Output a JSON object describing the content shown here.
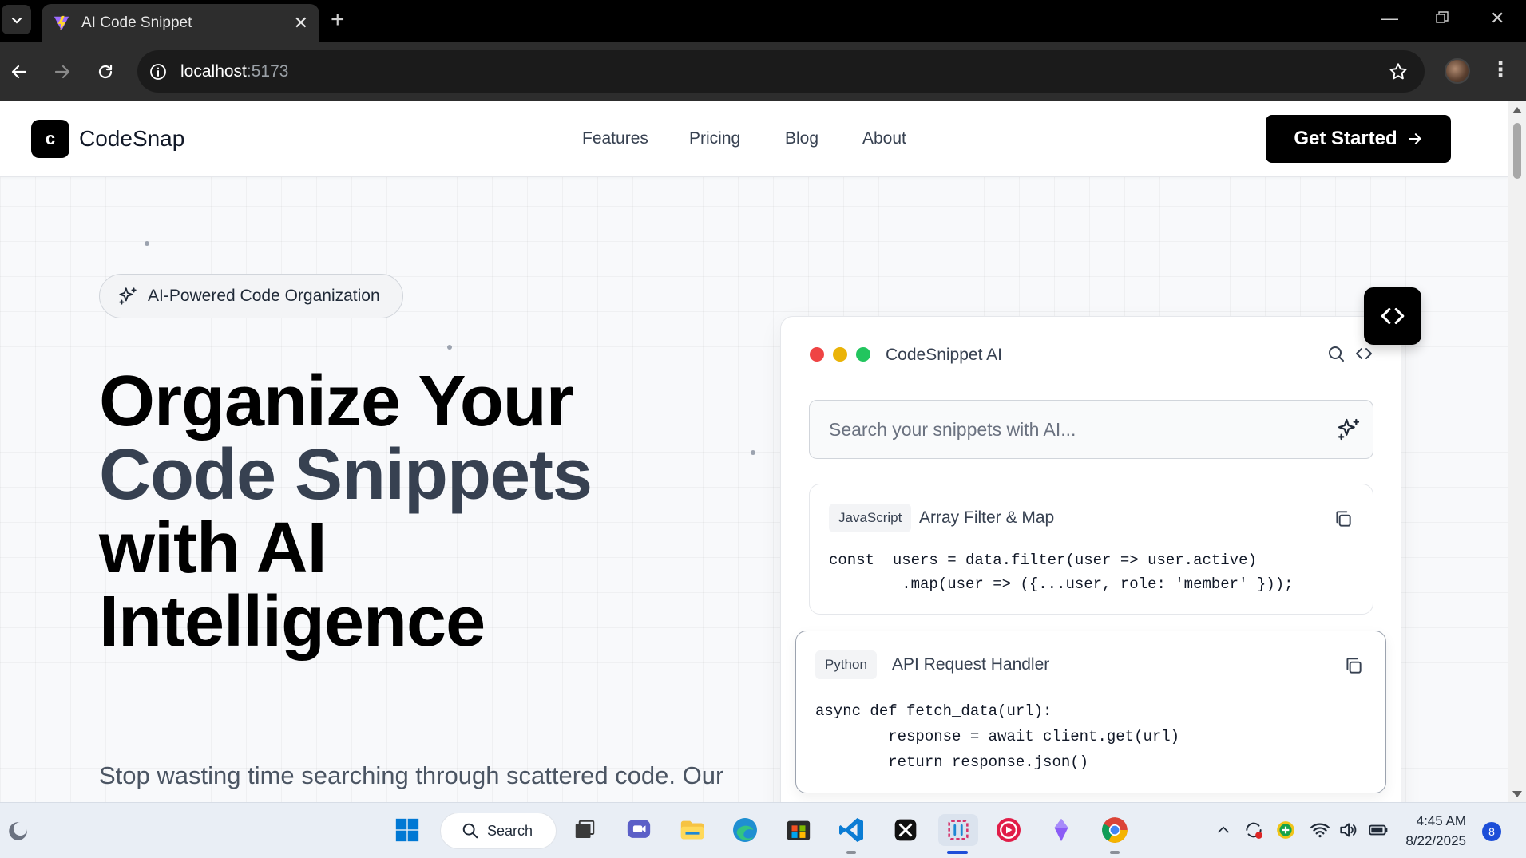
{
  "browser": {
    "tab_title": "AI Code Snippet",
    "url_host": "localhost",
    "url_port": ":5173"
  },
  "site": {
    "logo_letter": "c",
    "logo_text": "CodeSnap",
    "nav": [
      "Features",
      "Pricing",
      "Blog",
      "About"
    ],
    "cta_label": "Get Started"
  },
  "hero": {
    "badge": "AI-Powered Code Organization",
    "title_line1": "Organize Your",
    "title_line2": "Code Snippets",
    "title_line3": "with AI",
    "title_line4": "Intelligence",
    "subtitle": "Stop wasting time searching through scattered code. Our"
  },
  "panel": {
    "title": "CodeSnippet AI",
    "search_placeholder": "Search your snippets with AI...",
    "snippets": [
      {
        "language": "JavaScript",
        "title": "Array Filter & Map",
        "code": "const  users = data.filter(user => user.active)\n        .map(user => ({...user, role: 'member' }));"
      },
      {
        "language": "Python",
        "title": "API Request Handler",
        "code": "async def fetch_data(url):\n        response = await client.get(url)\n        return response.json()"
      }
    ]
  },
  "taskbar": {
    "search_label": "Search",
    "time": "4:45 AM",
    "date": "8/22/2025",
    "notification_count": "8"
  },
  "colors": {
    "accent_black": "#000000",
    "traffic_red": "#ef4444",
    "traffic_yellow": "#eab308",
    "traffic_green": "#22c55e"
  }
}
